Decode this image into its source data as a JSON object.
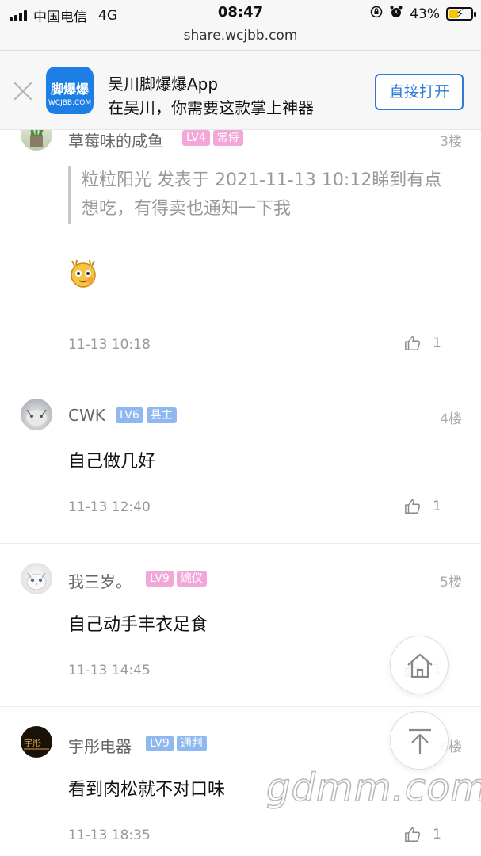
{
  "status_bar": {
    "carrier": "中国电信",
    "network": "4G",
    "time": "08:47",
    "battery_percent": "43%",
    "battery_level": 0.43
  },
  "url": "share.wcjbb.com",
  "banner": {
    "logo_line1": "脚爆爆",
    "logo_line2": "WCJBB.COM",
    "app_name": "吴川脚爆爆App",
    "app_subtitle": "在吴川，你需要这款掌上神器",
    "open_label": "直接打开",
    "peek_time": "11-13 10:12"
  },
  "posts": [
    {
      "username": "草莓味的咸鱼",
      "level": "LV4",
      "title": "常侍",
      "floor": "3楼",
      "quote": "粒粒阳光 发表于 2021-11-13 10:12睇到有点想吃，有得卖也通知一下我",
      "content": "",
      "time": "11-13 10:18",
      "likes": "1"
    },
    {
      "username": "CWK",
      "level": "LV6",
      "title": "县主",
      "floor": "4楼",
      "content": "自己做几好",
      "time": "11-13 12:40",
      "likes": "1"
    },
    {
      "username": "我三岁。",
      "level": "LV9",
      "title": "婉仪",
      "floor": "5楼",
      "content": "自己动手丰衣足食",
      "time": "11-13 14:45",
      "likes": "1"
    },
    {
      "username": "宇彤电器",
      "level": "LV9",
      "title": "通判",
      "floor": "6楼",
      "content": "看到肉松就不对口味",
      "time": "11-13 18:35",
      "likes": "1"
    }
  ],
  "watermark": "gdmm.com",
  "colors": {
    "accent": "#2f7ad8",
    "badge_pink": "#f3a6d8",
    "badge_blue": "#8fb8f0"
  }
}
